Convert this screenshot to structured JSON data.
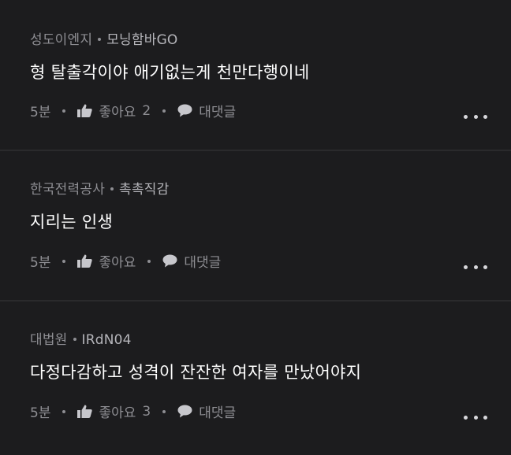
{
  "comments": [
    {
      "author": "성도이엔지",
      "nickname": "모닝함바GO",
      "text": "형 탈출각이야 애기없는게 천만다행이네",
      "time": "5분",
      "like_label": "좋아요",
      "like_count": "2",
      "reply_label": "대댓글"
    },
    {
      "author": "한국전력공사",
      "nickname": "촉촉직감",
      "text": "지리는 인생",
      "time": "5분",
      "like_label": "좋아요",
      "like_count": "",
      "reply_label": "대댓글"
    },
    {
      "author": "대법원",
      "nickname": "IRdN04",
      "text": "다정다감하고 성격이 잔잔한 여자를 만났어야지",
      "time": "5분",
      "like_label": "좋아요",
      "like_count": "3",
      "reply_label": "대댓글"
    }
  ],
  "icons": {
    "like": "thumbs-up-icon",
    "reply": "speech-bubble-icon",
    "more": "more-horizontal-icon"
  },
  "colors": {
    "background": "#1c1c1e",
    "text": "#ffffff",
    "muted": "#8e8e93",
    "divider": "#2a2a2c"
  }
}
